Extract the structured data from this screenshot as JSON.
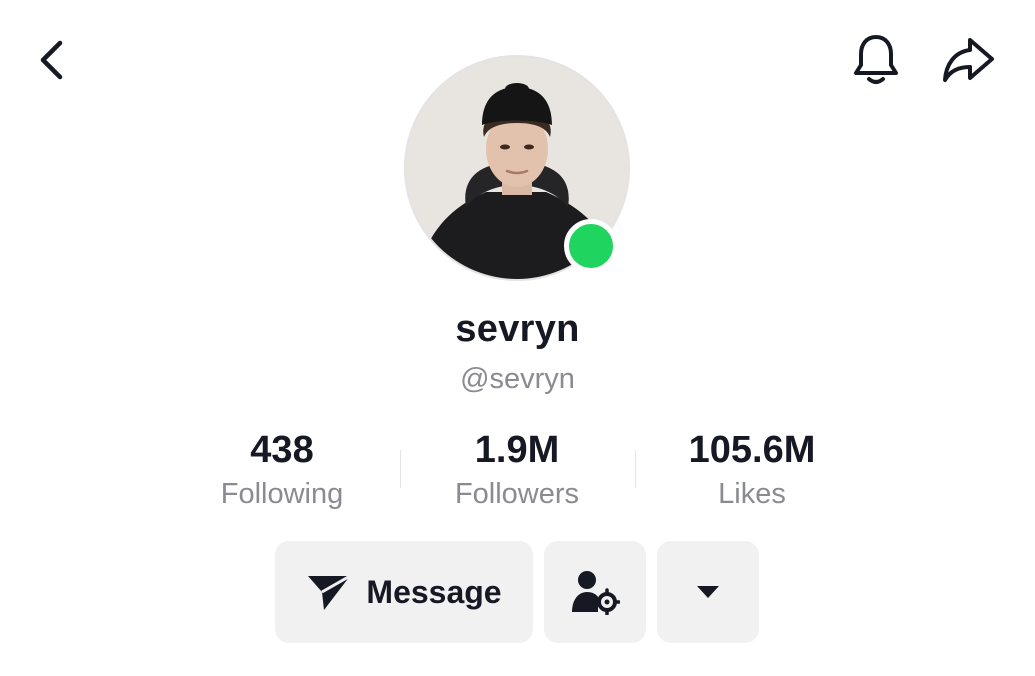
{
  "header": {
    "back_icon": "chevron-left-icon",
    "bell_icon": "bell-icon",
    "share_icon": "share-arrow-icon"
  },
  "profile": {
    "display_name": "sevryn",
    "handle": "@sevryn",
    "online": true,
    "online_color": "#20d55f"
  },
  "stats": [
    {
      "value": "438",
      "label": "Following"
    },
    {
      "value": "1.9M",
      "label": "Followers"
    },
    {
      "value": "105.6M",
      "label": "Likes"
    }
  ],
  "actions": {
    "message_label": "Message",
    "message_icon": "send-icon",
    "friends_icon": "user-settings-icon",
    "more_icon": "caret-down-icon"
  }
}
